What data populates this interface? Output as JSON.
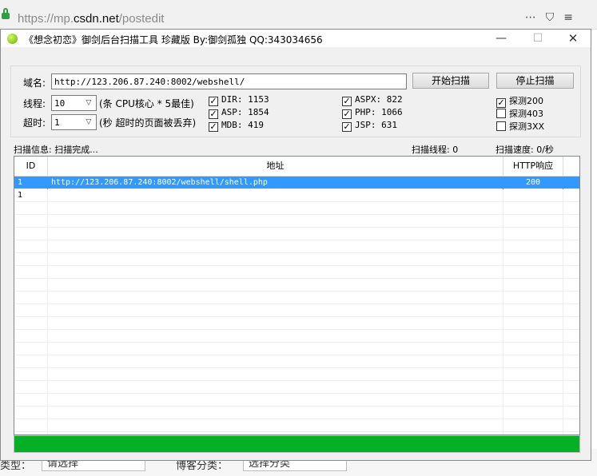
{
  "browser": {
    "url_prefix": "https://mp.",
    "url_host": "csdn.net",
    "url_path": "/postedit"
  },
  "background_form": {
    "label_left": "类型：",
    "select_left": "请选择",
    "label_right": "博客分类：",
    "select_right": "选择分类"
  },
  "window": {
    "title": "《想念初恋》御剑后台扫描工具 珍藏版 By:御剑孤独 QQ:343034656",
    "minimize": "—",
    "maximize": "☐",
    "close": "✕"
  },
  "form": {
    "domain_label": "域名:",
    "domain_value": "http://123.206.87.240:8002/webshell/",
    "start_button": "开始扫描",
    "stop_button": "停止扫描",
    "threads_label": "线程:",
    "threads_value": "10",
    "threads_hint": "(条 CPU核心 * 5最佳)",
    "timeout_label": "超时:",
    "timeout_value": "1",
    "timeout_hint": "(秒 超时的页面被丢弃)"
  },
  "dictionaries": [
    {
      "label": "DIR: 1153",
      "checked": true
    },
    {
      "label": "ASP: 1854",
      "checked": true
    },
    {
      "label": "MDB: 419",
      "checked": true
    },
    {
      "label": "ASPX: 822",
      "checked": true
    },
    {
      "label": "PHP: 1066",
      "checked": true
    },
    {
      "label": "JSP: 631",
      "checked": true
    }
  ],
  "probes": [
    {
      "label": "探测200",
      "checked": true
    },
    {
      "label": "探测403",
      "checked": false
    },
    {
      "label": "探测3XX",
      "checked": false
    }
  ],
  "status": {
    "info": "扫描信息: 扫描完成...",
    "threads": "扫描线程: 0",
    "speed": "扫描速度: 0/秒"
  },
  "table": {
    "headers": [
      "ID",
      "地址",
      "HTTP响应"
    ],
    "rows": [
      {
        "id": "1",
        "address": "http://123.206.87.240:8002/webshell/shell.php",
        "code": "200",
        "selected": true
      },
      {
        "id": "1",
        "address": "",
        "code": "",
        "selected": false
      }
    ]
  },
  "progress": {
    "fraction": 1.0
  },
  "colors": {
    "selection": "#3399ff",
    "progress": "#06b025"
  }
}
